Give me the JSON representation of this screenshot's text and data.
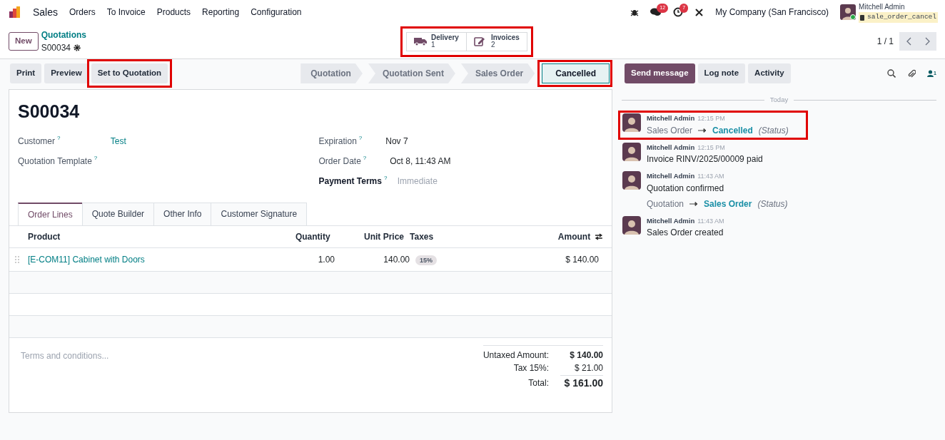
{
  "navbar": {
    "app": "Sales",
    "menu": [
      "Orders",
      "To Invoice",
      "Products",
      "Reporting",
      "Configuration"
    ],
    "messages_badge": "12",
    "activities_badge": "7",
    "company": "My Company (San Francisco)",
    "user": "Mitchell Admin",
    "database": "sale_order_cancel"
  },
  "control_panel": {
    "new_button": "New",
    "breadcrumb": "Quotations",
    "record": "S00034",
    "smart_buttons_highlighted": true,
    "smart_buttons": [
      {
        "kind": "delivery",
        "label": "Delivery",
        "count": "1"
      },
      {
        "kind": "invoice",
        "label": "Invoices",
        "count": "2"
      }
    ],
    "pager": "1 / 1"
  },
  "actions": [
    {
      "label": "Print",
      "highlighted": false
    },
    {
      "label": "Preview",
      "highlighted": false
    },
    {
      "label": "Set to Quotation",
      "highlighted": true
    }
  ],
  "statusbar": [
    {
      "label": "Quotation",
      "selected": false,
      "highlighted": false
    },
    {
      "label": "Quotation Sent",
      "selected": false,
      "highlighted": false
    },
    {
      "label": "Sales Order",
      "selected": false,
      "highlighted": false
    },
    {
      "label": "Cancelled",
      "selected": true,
      "highlighted": true
    }
  ],
  "form": {
    "title": "S00034",
    "fields_left": [
      {
        "label": "Customer",
        "help": "?",
        "value": "Test",
        "kind": "link",
        "required": false
      },
      {
        "label": "Quotation Template",
        "help": "?",
        "kind": "empty",
        "required": false
      }
    ],
    "fields_right": [
      {
        "label": "Expiration",
        "help": "?",
        "value": "Nov 7",
        "kind": "plain",
        "required": false
      },
      {
        "label": "Order Date",
        "help": "?",
        "value": "Oct 8, 11:43 AM",
        "kind": "plain",
        "required": false
      },
      {
        "label": "Payment Terms",
        "help": "?",
        "placeholder": "Immediate",
        "kind": "placeholder",
        "required": true
      }
    ],
    "tabs": [
      {
        "label": "Order Lines",
        "selected": true
      },
      {
        "label": "Quote Builder",
        "selected": false
      },
      {
        "label": "Other Info",
        "selected": false
      },
      {
        "label": "Customer Signature",
        "selected": false
      }
    ],
    "table": {
      "columns": [
        "Product",
        "Quantity",
        "Unit Price",
        "Taxes",
        "Amount"
      ],
      "rows": [
        {
          "product": "[E-COM11] Cabinet with Doors",
          "quantity": "1.00",
          "unit_price": "140.00",
          "taxes": "15%",
          "amount": "$ 140.00"
        }
      ]
    },
    "terms_placeholder": "Terms and conditions...",
    "totals": [
      {
        "label": "Untaxed Amount:",
        "value": "$ 140.00",
        "kind": "bold"
      },
      {
        "label": "Tax 15%:",
        "value": "$ 21.00",
        "kind": "normal"
      },
      {
        "label": "Total:",
        "value": "$ 161.00",
        "kind": "grand"
      }
    ]
  },
  "chatter": {
    "buttons": [
      {
        "label": "Send message",
        "primary": true
      },
      {
        "label": "Log note",
        "primary": false
      },
      {
        "label": "Activity",
        "primary": false
      }
    ],
    "followers_count": "1",
    "date": "Today",
    "messages": [
      {
        "author": "Mitchell Admin",
        "time": "12:15 PM",
        "tracking": {
          "old": "Sales Order",
          "new": "Cancelled",
          "field": "(Status)"
        },
        "highlighted": true
      },
      {
        "author": "Mitchell Admin",
        "time": "12:15 PM",
        "body": "Invoice RINV/2025/00009 paid",
        "highlighted": false
      },
      {
        "author": "Mitchell Admin",
        "time": "11:43 AM",
        "body": "Quotation confirmed",
        "tracking": {
          "old": "Quotation",
          "new": "Sales Order",
          "field": "(Status)"
        },
        "highlighted": false
      },
      {
        "author": "Mitchell Admin",
        "time": "11:43 AM",
        "body": "Sales Order created",
        "highlighted": false
      }
    ]
  }
}
